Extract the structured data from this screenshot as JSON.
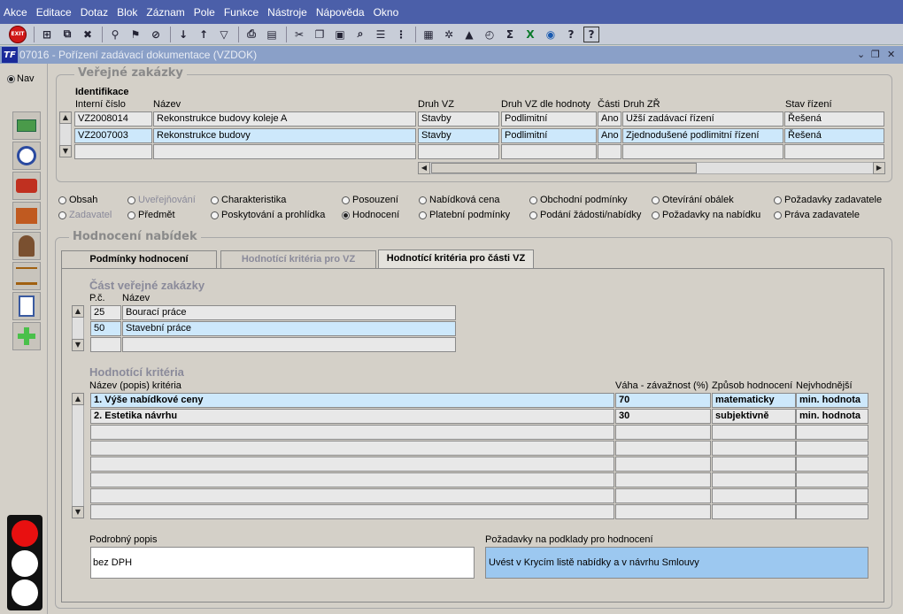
{
  "menu": [
    "Akce",
    "Editace",
    "Dotaz",
    "Blok",
    "Záznam",
    "Pole",
    "Funkce",
    "Nástroje",
    "Nápověda",
    "Okno"
  ],
  "toolbar": {
    "exit_label": "EXIT"
  },
  "window": {
    "title": "07016 - Pořízení zadávací dokumentace (VZDOK)",
    "logo": "TF"
  },
  "left": {
    "nav_label": "Nav"
  },
  "verejne": {
    "title": "Veřejné zakázky",
    "section": "Identifikace",
    "headers": {
      "interni": "Interní číslo",
      "nazev": "Název",
      "druh": "Druh VZ",
      "druh_hod": "Druh VZ dle hodnoty",
      "casti": "Části",
      "druh_zr": "Druh ZŘ",
      "stav": "Stav řízení"
    },
    "rows": [
      {
        "interni": "VZ2008014",
        "nazev": "Rekonstrukce budovy koleje A",
        "druh": "Stavby",
        "druh_hod": "Podlimitní",
        "casti": "Ano",
        "druh_zr": "Užší zadávací řízení",
        "stav": "Řešená"
      },
      {
        "interni": "VZ2007003",
        "nazev": "Rekonstrukce budovy",
        "druh": "Stavby",
        "druh_hod": "Podlimitní",
        "casti": "Ano",
        "druh_zr": "Zjednodušené podlimitní řízení",
        "stav": "Řešená"
      }
    ]
  },
  "radios": {
    "row1": [
      "Obsah",
      "Uveřejňování",
      "Charakteristika",
      "Posouzení",
      "Nabídková cena",
      "Obchodní podmínky",
      "Otevírání obálek",
      "Požadavky zadavatele"
    ],
    "row2": [
      "Zadavatel",
      "Předmět",
      "Poskytování a prohlídka",
      "Hodnocení",
      "Platební podmínky",
      "Podání žádosti/nabídky",
      "Požadavky na nabídku",
      "Práva zadavatele"
    ]
  },
  "hodnoceni": {
    "title": "Hodnocení nabídek",
    "tabs": [
      "Podmínky hodnocení",
      "Hodnotící kritéria pro VZ",
      "Hodnotící kritéria pro části VZ"
    ],
    "cast_title": "Část veřejné zakázky",
    "cast_headers": {
      "pc": "P.č.",
      "nazev": "Název"
    },
    "cast_rows": [
      {
        "pc": "25",
        "nazev": "Bourací práce"
      },
      {
        "pc": "50",
        "nazev": "Stavební práce"
      }
    ],
    "krit_title": "Hodnotící kritéria",
    "krit_headers": {
      "nazev": "Název (popis) kritéria",
      "vaha": "Váha - závažnost (%)",
      "zpusob": "Způsob hodnocení",
      "nejv": "Nejvhodnější"
    },
    "krit_rows": [
      {
        "nazev": "1.  Výše nabídkové ceny",
        "vaha": "70",
        "zpusob": "matematicky",
        "nejv": "min. hodnota"
      },
      {
        "nazev": "2.  Estetika návrhu",
        "vaha": "30",
        "zpusob": "subjektivně",
        "nejv": "min. hodnota"
      }
    ],
    "popis_label": "Podrobný popis",
    "popis_value": "bez DPH",
    "pozad_label": "Požadavky na podklady pro hodnocení",
    "pozad_value": "Uvést v Krycím listě nabídky a v návrhu Smlouvy"
  }
}
